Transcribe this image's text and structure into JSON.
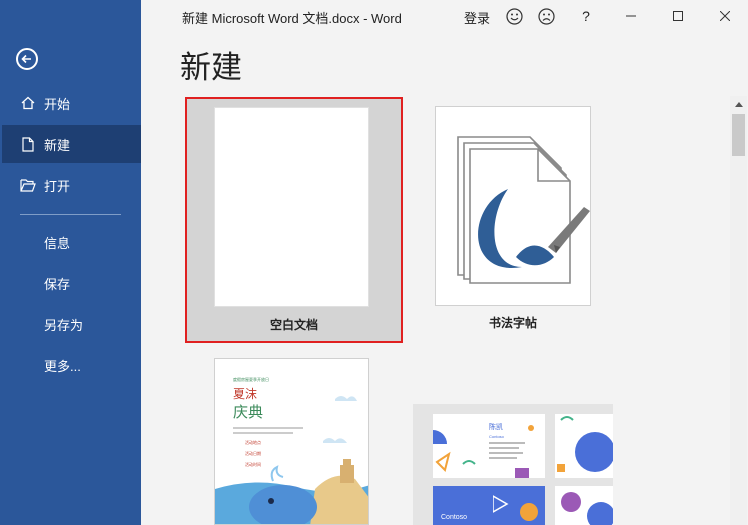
{
  "titlebar": {
    "title": "新建 Microsoft Word 文档.docx - Word",
    "sign_in": "登录",
    "smile_icon": "smile-face-icon",
    "frown_icon": "frown-face-icon",
    "help": "?"
  },
  "sidebar": {
    "back_icon": "back-arrow-icon",
    "items": [
      {
        "label": "开始",
        "icon": "home-icon"
      },
      {
        "label": "新建",
        "icon": "new-document-icon",
        "active": true
      },
      {
        "label": "打开",
        "icon": "folder-open-icon"
      },
      {
        "label": "信息"
      },
      {
        "label": "保存"
      },
      {
        "label": "另存为"
      },
      {
        "label": "更多..."
      }
    ]
  },
  "main": {
    "title": "新建",
    "templates": [
      {
        "label": "空白文档",
        "selected": true
      },
      {
        "label": "书法字帖"
      }
    ],
    "flyer": {
      "line1": "度假房屋夏季开放日",
      "heading1": "夏沫",
      "heading2": "庆典",
      "info": [
        "活动地点",
        "活动日期",
        "活动时间"
      ]
    },
    "business_card": {
      "name": "陈凯",
      "brand": "Contoso",
      "brand2": "Contoso"
    }
  },
  "colors": {
    "sidebar": "#2b579a",
    "sidebar_active": "#1e3f73",
    "selection_border": "#e02020",
    "accent_blue": "#4a6fd8"
  }
}
